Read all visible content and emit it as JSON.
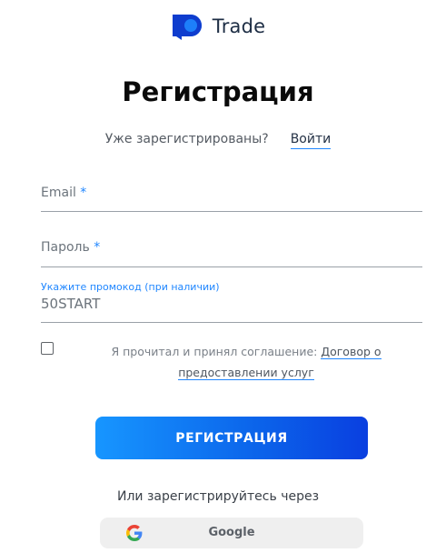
{
  "brand": {
    "name": "Trade",
    "icon": "brand-logo-icon"
  },
  "page": {
    "title": "Регистрация"
  },
  "login": {
    "question": "Уже зарегистрированы?",
    "link": "Войти"
  },
  "form": {
    "email_label": "Email",
    "password_label": "Пароль",
    "required_mark": "*",
    "promo_label": "Укажите промокод (при наличии)",
    "promo_value": "50START"
  },
  "agreement": {
    "checked": false,
    "text": "Я прочитал и принял соглашение: ",
    "link": "Договор о предоставлении услуг"
  },
  "register_button": {
    "label": "РЕГИСТРАЦИЯ"
  },
  "alt": {
    "text": "Или зарегистрируйтесь через"
  },
  "google_button": {
    "label": "Google",
    "icon": "google-icon"
  },
  "colors": {
    "accent": "#1f86ff",
    "button_start": "#1796ff",
    "button_end": "#0a3fe0"
  }
}
